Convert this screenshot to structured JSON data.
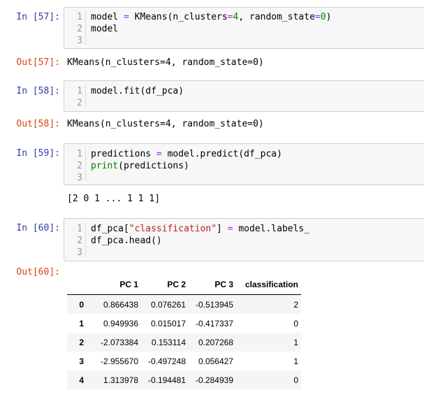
{
  "cells": [
    {
      "in_prompt": "In [57]:",
      "lines": [
        {
          "no": "1",
          "text": "model = KMeans(n_clusters=4, random_state=0)"
        },
        {
          "no": "2",
          "text": "model"
        },
        {
          "no": "3",
          "text": ""
        }
      ],
      "out_prompt": "Out[57]:",
      "output": "KMeans(n_clusters=4, random_state=0)"
    },
    {
      "in_prompt": "In [58]:",
      "lines": [
        {
          "no": "1",
          "text": "model.fit(df_pca)"
        },
        {
          "no": "2",
          "text": ""
        }
      ],
      "out_prompt": "Out[58]:",
      "output": "KMeans(n_clusters=4, random_state=0)"
    },
    {
      "in_prompt": "In [59]:",
      "lines": [
        {
          "no": "1",
          "text": "predictions = model.predict(df_pca)"
        },
        {
          "no": "2",
          "text": "print(predictions)"
        },
        {
          "no": "3",
          "text": ""
        }
      ],
      "output": "[2 0 1 ... 1 1 1]"
    },
    {
      "in_prompt": "In [60]:",
      "lines": [
        {
          "no": "1",
          "text": "df_pca[\"classification\"] = model.labels_"
        },
        {
          "no": "2",
          "text": "df_pca.head()"
        },
        {
          "no": "3",
          "text": ""
        }
      ],
      "out_prompt": "Out[60]:"
    }
  ],
  "dataframe": {
    "columns": [
      "",
      "PC 1",
      "PC 2",
      "PC 3",
      "classification"
    ],
    "rows": [
      [
        "0",
        "0.866438",
        "0.076261",
        "-0.513945",
        "2"
      ],
      [
        "1",
        "0.949936",
        "0.015017",
        "-0.417337",
        "0"
      ],
      [
        "2",
        "-2.073384",
        "0.153114",
        "0.207268",
        "1"
      ],
      [
        "3",
        "-2.955670",
        "-0.497248",
        "0.056427",
        "1"
      ],
      [
        "4",
        "1.313978",
        "-0.194481",
        "-0.284939",
        "0"
      ]
    ]
  },
  "colors": {
    "in_prompt": "#303f9f",
    "out_prompt": "#d84315",
    "keyword": "#008000",
    "operator": "#aa22ff",
    "string": "#ba2121"
  }
}
